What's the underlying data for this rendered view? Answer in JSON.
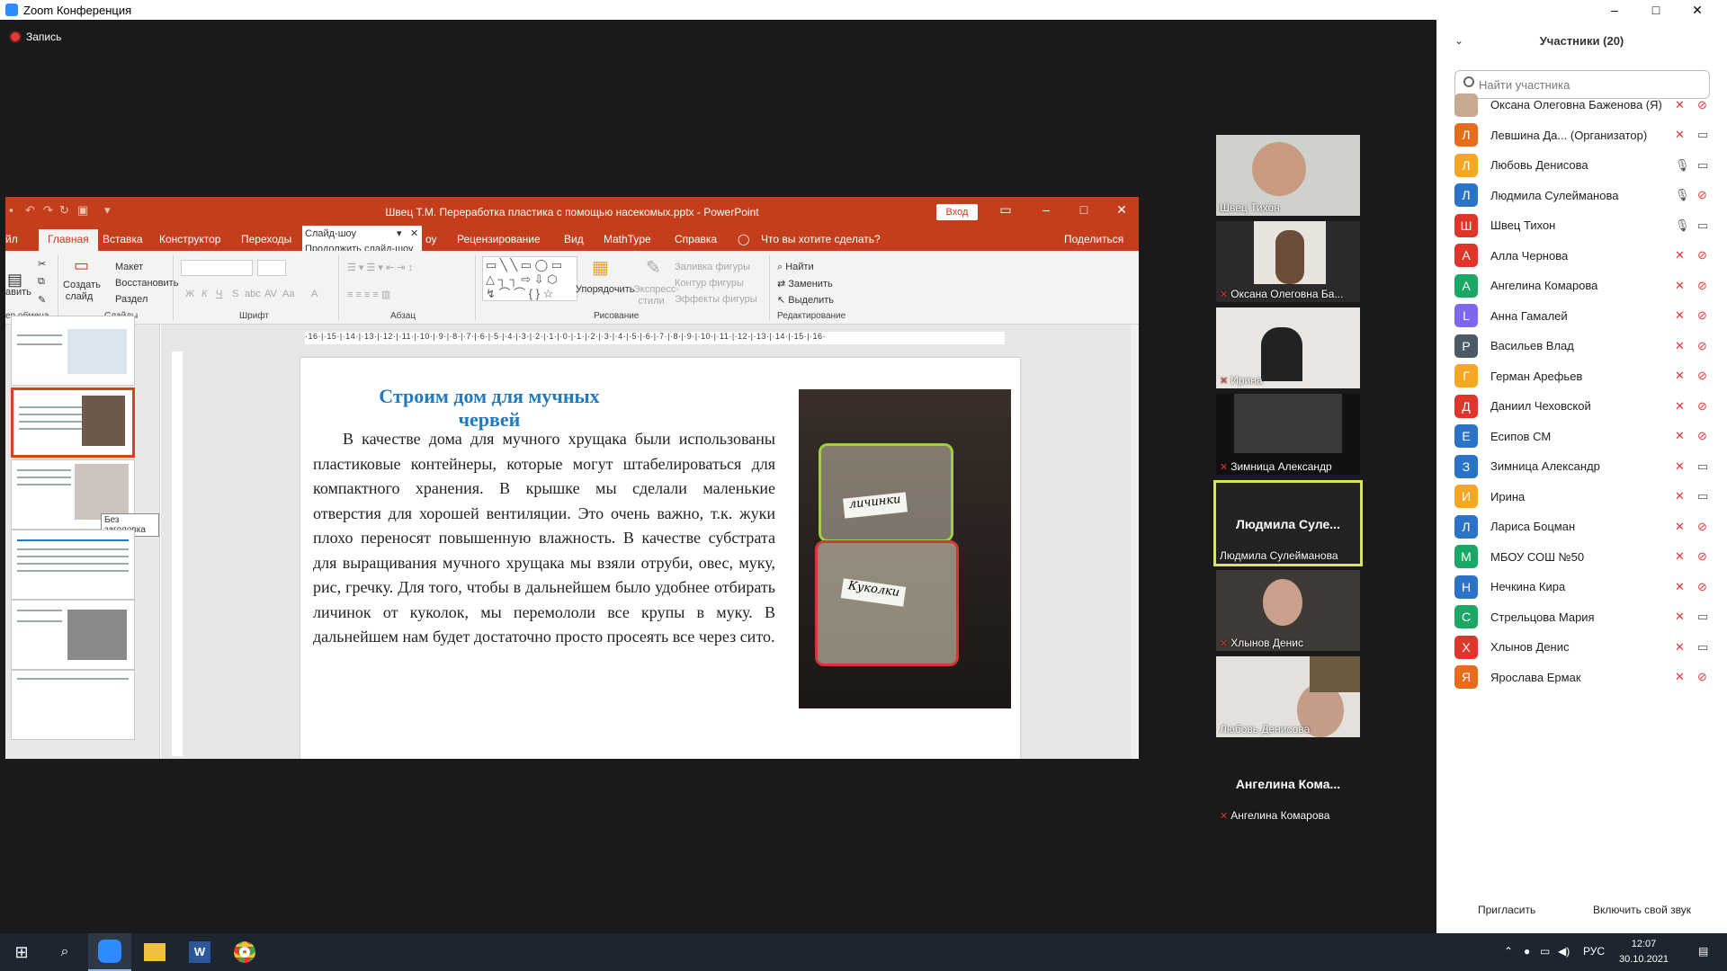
{
  "window": {
    "title": "Zoom Конференция",
    "minimize": "–",
    "maximize": "□",
    "close": "✕"
  },
  "recording": {
    "label": "Запись"
  },
  "powerpoint": {
    "doc_title": "Швец Т.М. Переработка пластика с помощью насекомых.pptx - PowerPoint",
    "signin": "Вход",
    "tabs": [
      "йл",
      "Главная",
      "Вставка",
      "Конструктор",
      "Переходы",
      "оу",
      "Рецензирование",
      "Вид",
      "MathType",
      "Справка"
    ],
    "tell_me": "Что вы хотите сделать?",
    "share": "Поделиться",
    "slideshow_popup": {
      "title": "Слайд-шоу",
      "item": "Продолжить слайд-шоу"
    },
    "ribbon": {
      "paste": "авить",
      "clipboard": "ер обмена",
      "new_slide": "Создать слайд",
      "layout": "Макет",
      "reset": "Восстановить",
      "section": "Раздел",
      "slides": "Слайды",
      "font": "Шрифт",
      "paragraph": "Абзац",
      "arrange": "Упорядочить",
      "quick_styles": "Экспресс-стили",
      "fill": "Заливка фигуры",
      "outline": "Контур фигуры",
      "effects": "Эффекты фигуры",
      "drawing": "Рисование",
      "find": "Найти",
      "replace": "Заменить",
      "select": "Выделить",
      "editing": "Редактирование",
      "bold": "Ж",
      "italic": "К",
      "underline": "Ч",
      "strike": "S",
      "shadow": "abc",
      "spacing": "AV",
      "case": "Aa",
      "color": "A"
    },
    "ruler": "·16·|·15·|·14·|·13·|·12·|·11·|·10·|·9·|·8·|·7·|·6·|·5·|·4·|·3·|·2·|·1·|·0·|·1·|·2·|·3·|·4·|·5·|·6·|·7·|·8·|·9·|·10·|·11·|·12·|·13·|·14·|·15·|·16·",
    "thumb_tooltip": "Без заголовка",
    "slide": {
      "title": "Строим дом для мучных червей",
      "body": "В качестве дома для мучного хрущака были использованы пластиковые контейнеры, которые могут штабелироваться для компактного хранения. В крышке мы сделали маленькие отверстия для хорошей вентиляции. Это очень важно, т.к. жуки плохо переносят повышенную влажность. В качестве субстрата для выращивания мучного хрущака мы взяли отруби, овес, муку, рис, гречку. Для того, чтобы в дальнейшем было удобнее отбирать личинок от куколок, мы перемололи все крупы в муку. В дальнейшем нам будет достаточно просто просеять все через сито.",
      "photo_labels": [
        "личинки",
        "Куколки"
      ]
    }
  },
  "video_tiles": [
    {
      "name": "Швец Тихон",
      "muted": false
    },
    {
      "name": "Оксана Олеговна Ба...",
      "muted": true
    },
    {
      "name": "Ирина",
      "muted": true
    },
    {
      "name": "Зимница Александр",
      "muted": true
    },
    {
      "name": "Людмила Сулейманова",
      "big": "Людмила  Суле...",
      "muted": false,
      "speaking": true
    },
    {
      "name": "Хлынов Денис",
      "muted": true
    },
    {
      "name": "Любовь Денисова",
      "muted": false
    },
    {
      "name": "Ангелина Комарова",
      "big": "Ангелина  Кома...",
      "muted": true
    }
  ],
  "panel": {
    "title": "Участники (20)",
    "search_placeholder": "Найти участника",
    "participants": [
      {
        "initial": "",
        "name": "Оксана Олеговна Баженова (Я)",
        "color": "#c9a890",
        "mic": "off",
        "cam": "off"
      },
      {
        "initial": "Л",
        "name": "Левшина Да...  (Организатор)",
        "color": "#e86c1a",
        "mic": "off",
        "cam": "on"
      },
      {
        "initial": "Л",
        "name": "Любовь Денисова",
        "color": "#f5a623",
        "mic": "on",
        "cam": "on"
      },
      {
        "initial": "Л",
        "name": "Людмила Сулейманова",
        "color": "#2b73c7",
        "mic": "on",
        "cam": "off"
      },
      {
        "initial": "Ш",
        "name": "Швец Тихон",
        "color": "#e0352b",
        "mic": "on",
        "cam": "on"
      },
      {
        "initial": "А",
        "name": "Алла Чернова",
        "color": "#e0352b",
        "mic": "off",
        "cam": "off"
      },
      {
        "initial": "А",
        "name": "Ангелина Комарова",
        "color": "#1aa867",
        "mic": "off",
        "cam": "off"
      },
      {
        "initial": "L",
        "name": "Анна Гамалей",
        "color": "#7b68ee",
        "mic": "off",
        "cam": "off"
      },
      {
        "initial": "Р",
        "name": "Васильев Влад",
        "color": "#4a5a66",
        "mic": "off",
        "cam": "off"
      },
      {
        "initial": "Г",
        "name": "Герман Арефьев",
        "color": "#f5a623",
        "mic": "off",
        "cam": "off"
      },
      {
        "initial": "Д",
        "name": "Даниил Чеховской",
        "color": "#e0352b",
        "mic": "off",
        "cam": "off"
      },
      {
        "initial": "Е",
        "name": "Есипов СМ",
        "color": "#2b73c7",
        "mic": "off",
        "cam": "off"
      },
      {
        "initial": "З",
        "name": "Зимница Александр",
        "color": "#2b73c7",
        "mic": "off",
        "cam": "on"
      },
      {
        "initial": "И",
        "name": "Ирина",
        "color": "#f5a623",
        "mic": "off",
        "cam": "on"
      },
      {
        "initial": "Л",
        "name": "Лариса Боцман",
        "color": "#2b73c7",
        "mic": "off",
        "cam": "off"
      },
      {
        "initial": "М",
        "name": "МБОУ СОШ №50",
        "color": "#1aa867",
        "mic": "off",
        "cam": "off"
      },
      {
        "initial": "Н",
        "name": "Нечкина Кира",
        "color": "#2b73c7",
        "mic": "off",
        "cam": "off"
      },
      {
        "initial": "С",
        "name": "Стрельцова Мария",
        "color": "#1aa867",
        "mic": "off",
        "cam": "on"
      },
      {
        "initial": "Х",
        "name": "Хлынов Денис",
        "color": "#e0352b",
        "mic": "off",
        "cam": "on"
      },
      {
        "initial": "Я",
        "name": "Ярослава Ермак",
        "color": "#e86c1a",
        "mic": "off",
        "cam": "off"
      }
    ],
    "invite": "Пригласить",
    "unmute": "Включить свой звук"
  },
  "taskbar": {
    "lang": "РУС",
    "time": "12:07",
    "date": "30.10.2021"
  }
}
